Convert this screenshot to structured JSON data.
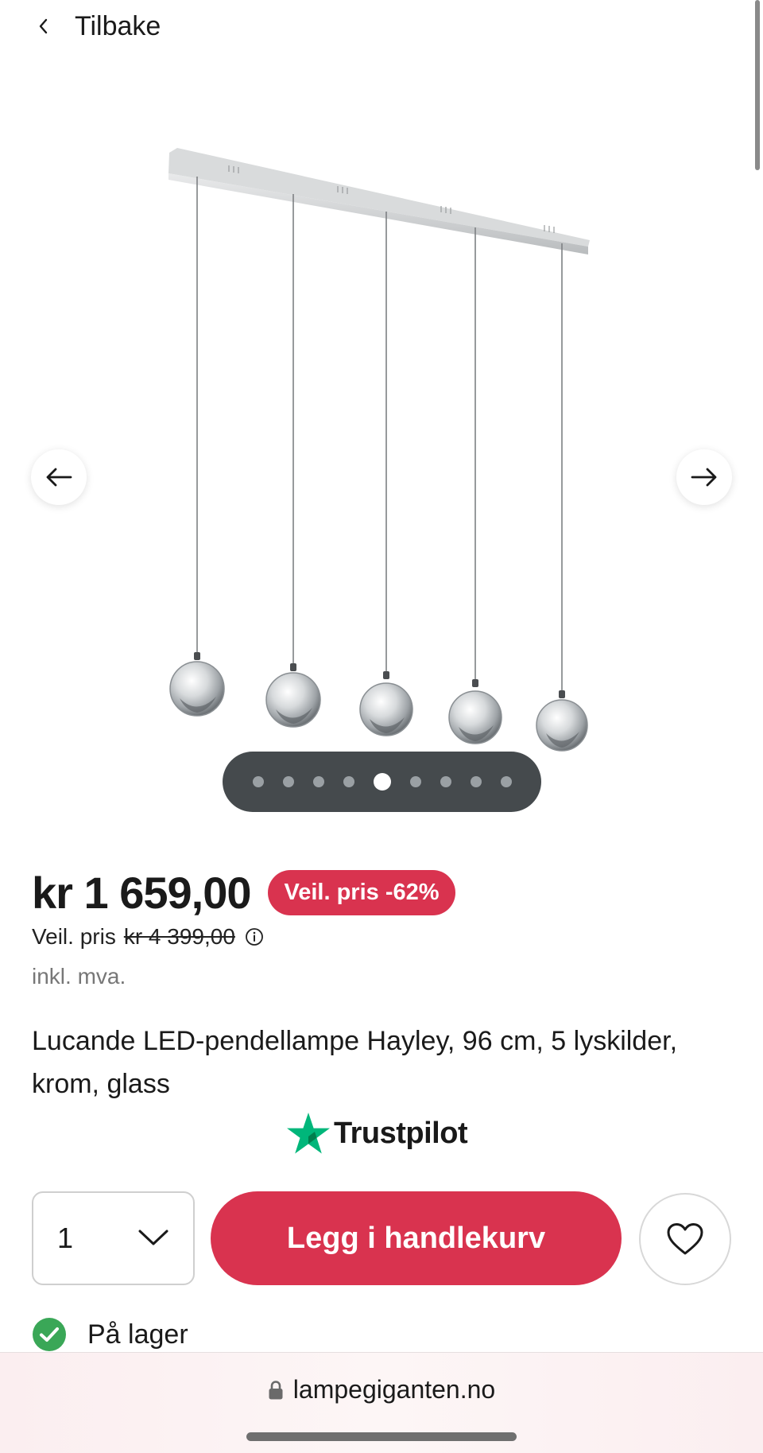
{
  "nav": {
    "back_label": "Tilbake"
  },
  "gallery": {
    "image_alt": "Pendellampe med fem glasskuler",
    "slide_count": 9,
    "active_slide": 5
  },
  "product": {
    "price": "kr 1 659,00",
    "discount_badge": "Veil. pris -62%",
    "rrp_label": "Veil. pris",
    "rrp_value": "kr 4 399,00",
    "vat_note": "inkl. mva.",
    "title": "Lucande LED-pendellampe Hayley, 96 cm, 5 lyskilder, krom, glass"
  },
  "trustpilot": {
    "label": "Trustpilot"
  },
  "buy": {
    "quantity": "1",
    "add_to_cart": "Legg i handlekurv"
  },
  "stock": {
    "label": "På lager"
  },
  "browser": {
    "url": "lampegiganten.no"
  },
  "colors": {
    "accent": "#d9334f",
    "dots_bg": "#454a4d",
    "stock_green": "#3aa757",
    "trustpilot_green": "#00b67a"
  },
  "icons": [
    "chevron-left-icon",
    "arrow-left-icon",
    "arrow-right-icon",
    "info-icon",
    "trustpilot-star-icon",
    "chevron-down-icon",
    "heart-icon",
    "check-circle-icon",
    "lock-icon"
  ]
}
